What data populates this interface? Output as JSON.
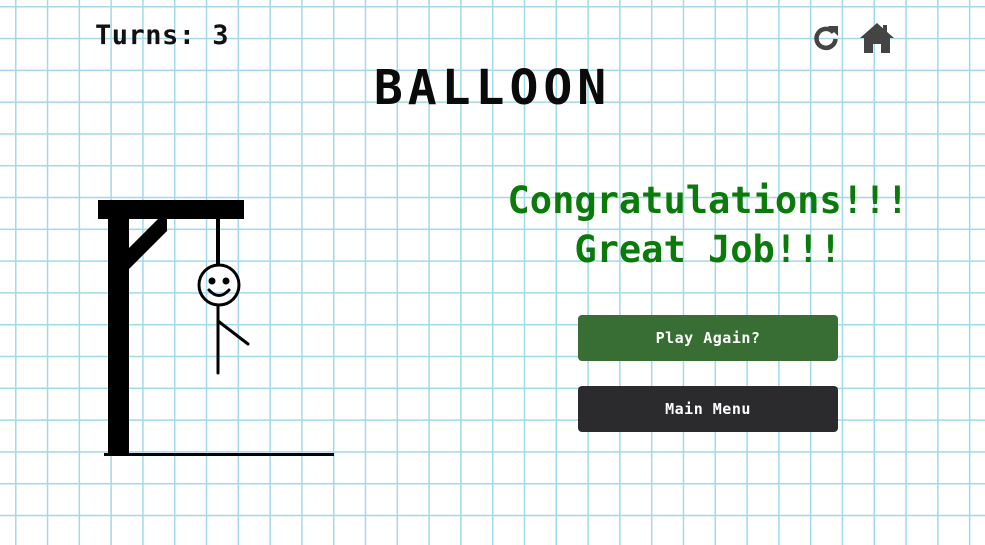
{
  "header": {
    "turns_text": "Turns: 3",
    "refresh_icon": "refresh-icon",
    "home_icon": "home-icon"
  },
  "game": {
    "word": "BALLOON",
    "hangman_figure": {
      "parts_shown": [
        "head",
        "smile-face",
        "body",
        "right-arm"
      ]
    }
  },
  "result": {
    "line1": "Congratulations!!!",
    "line2": "Great Job!!!",
    "color": "#0a7a0a"
  },
  "buttons": {
    "play_again_label": "Play Again?",
    "play_again_color": "#386e33",
    "main_menu_label": "Main Menu",
    "main_menu_color": "#2b2b2d"
  },
  "colors": {
    "grid_line": "#9fd9ea",
    "background": "#ffffff",
    "icon": "#444444"
  }
}
